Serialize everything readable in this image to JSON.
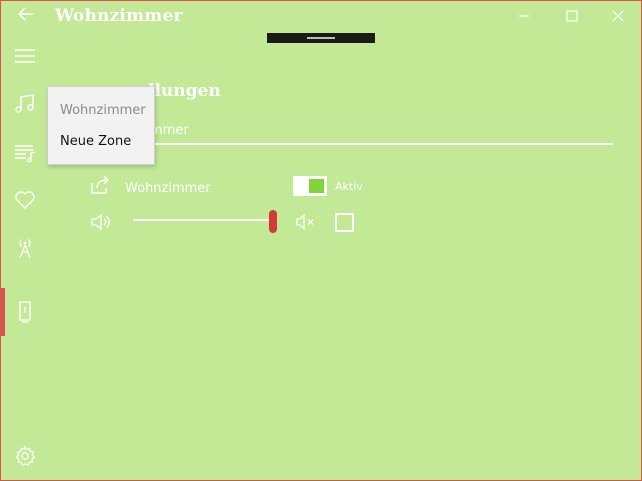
{
  "window": {
    "title": "Wohnzimmer",
    "back_icon": "back-arrow-icon",
    "minimize_icon": "minimize-icon",
    "maximize_icon": "maximize-icon",
    "close_icon": "close-icon"
  },
  "sidebar": {
    "items": [
      {
        "name": "hamburger-menu-icon"
      },
      {
        "name": "music-note-icon"
      },
      {
        "name": "playlist-icon"
      },
      {
        "name": "heart-icon"
      },
      {
        "name": "radio-tower-icon"
      },
      {
        "name": "speaker-device-icon",
        "active": true
      },
      {
        "name": "settings-gear-icon"
      }
    ]
  },
  "main": {
    "heading_fragment": "llungen",
    "input_fragment": "mmer"
  },
  "zone": {
    "share_icon": "share-icon",
    "name": "Wohnzimmer",
    "toggle_label": "Aktiv",
    "toggle_on": true,
    "volume_icon": "volume-icon",
    "volume_level": 1.0,
    "mute_icon": "mute-icon",
    "mute_checked": false
  },
  "context_menu": {
    "items": [
      {
        "label": "Wohnzimmer",
        "enabled": false
      },
      {
        "label": "Neue Zone",
        "enabled": true
      }
    ]
  },
  "colors": {
    "background": "#c3e896",
    "accent_green": "#82d43b",
    "accent_red": "#d33b3b",
    "foreground": "#ffffff"
  }
}
